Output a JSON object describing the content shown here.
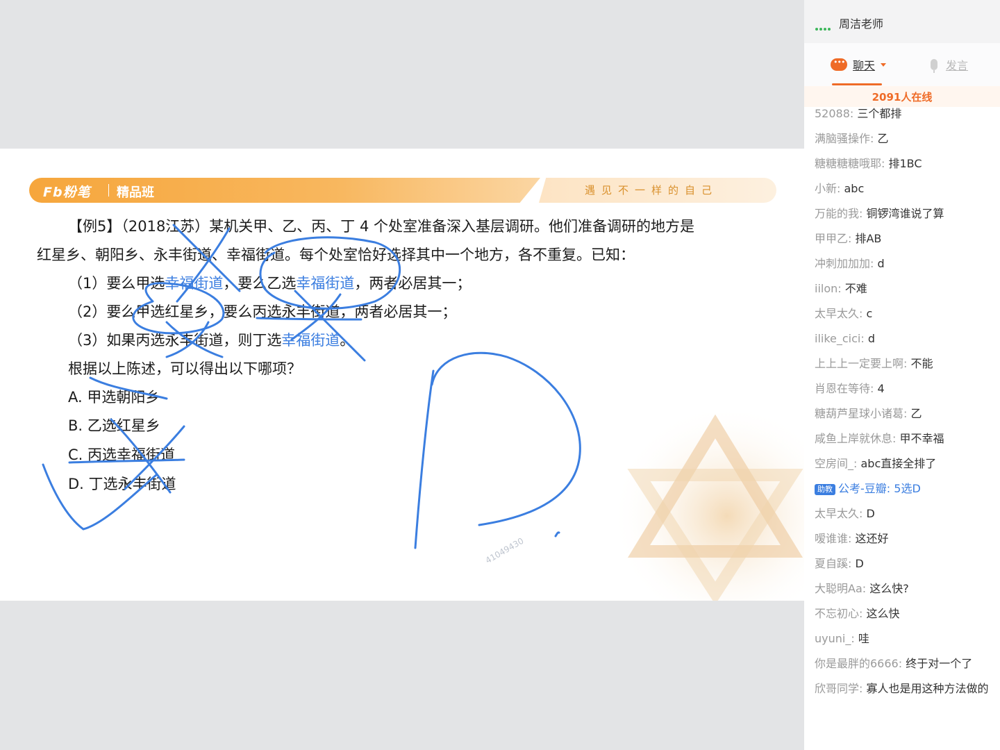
{
  "slide": {
    "brand_logo": "Fb粉笔",
    "course_label": "精品班",
    "slogan": "遇见不一样的自己",
    "question": {
      "line1": "【例5】（2018江苏）某机关甲、乙、丙、丁 4 个处室准备深入基层调研。他们准备调研的地方是",
      "line2": "红星乡、朝阳乡、永丰街道、幸福街道。每个处室恰好选择其中一个地方，各不重复。已知：",
      "c1_a": "（1）要么甲选",
      "c1_b": "幸福街道",
      "c1_c": "，要么乙选",
      "c1_d": "幸福街道",
      "c1_e": "，两者必居其一；",
      "c2": "（2）要么甲选红星乡，要么丙选永丰街道，两者必居其一；",
      "c3_a": "（3）如果丙选永丰街道，则丁选",
      "c3_b": "幸福街道",
      "c3_c": "。",
      "prompt": "根据以上陈述，可以得出以下哪项？",
      "options": [
        "A. 甲选朝阳乡",
        "B. 乙选红星乡",
        "C. 丙选幸福街道",
        "D. 丁选永丰街道"
      ]
    },
    "watermark_id": "41049430",
    "ink_color": "#3b7ee0"
  },
  "panel": {
    "teacher_name": "周洁老师",
    "tab_chat": "聊天",
    "tab_speak": "发言",
    "online_count": "2091人在线",
    "messages": [
      {
        "user": "52088",
        "text": "三个都排",
        "ta": false
      },
      {
        "user": "满脑骚操作",
        "text": "乙",
        "ta": false
      },
      {
        "user": "糖糖糖糖哦耶",
        "text": "排1BC",
        "ta": false
      },
      {
        "user": "小新",
        "text": "abc",
        "ta": false
      },
      {
        "user": "万能的我",
        "text": "铜锣湾谁说了算",
        "ta": false
      },
      {
        "user": "甲甲乙",
        "text": "排AB",
        "ta": false
      },
      {
        "user": "冲刺加加加",
        "text": "d",
        "ta": false
      },
      {
        "user": "iilon",
        "text": "不难",
        "ta": false
      },
      {
        "user": "太早太久",
        "text": "c",
        "ta": false
      },
      {
        "user": "ilike_cici",
        "text": "d",
        "ta": false
      },
      {
        "user": "上上上一定要上啊",
        "text": "不能",
        "ta": false
      },
      {
        "user": "肖恩在等待",
        "text": "4",
        "ta": false
      },
      {
        "user": "糖葫芦星球小诸葛",
        "text": "乙",
        "ta": false
      },
      {
        "user": "咸鱼上岸就休息",
        "text": "甲不幸福",
        "ta": false
      },
      {
        "user": "空房间_",
        "text": "abc直接全排了",
        "ta": false
      },
      {
        "user": "公考-豆瓣",
        "text": "5选D",
        "ta": true,
        "badge": "助教"
      },
      {
        "user": "太早太久",
        "text": "D",
        "ta": false
      },
      {
        "user": "嗳谁谁",
        "text": "这还好",
        "ta": false
      },
      {
        "user": "夏自蹊",
        "text": "D",
        "ta": false
      },
      {
        "user": "大聪明Aa",
        "text": "这么快?",
        "ta": false
      },
      {
        "user": "不忘初心",
        "text": "这么快",
        "ta": false
      },
      {
        "user": "uyuni_",
        "text": "哇",
        "ta": false
      },
      {
        "user": "你是最胖的6666",
        "text": "终于对一个了",
        "ta": false
      },
      {
        "user": "欣哥同学",
        "text": "寡人也是用这种方法做的",
        "ta": false
      }
    ]
  }
}
